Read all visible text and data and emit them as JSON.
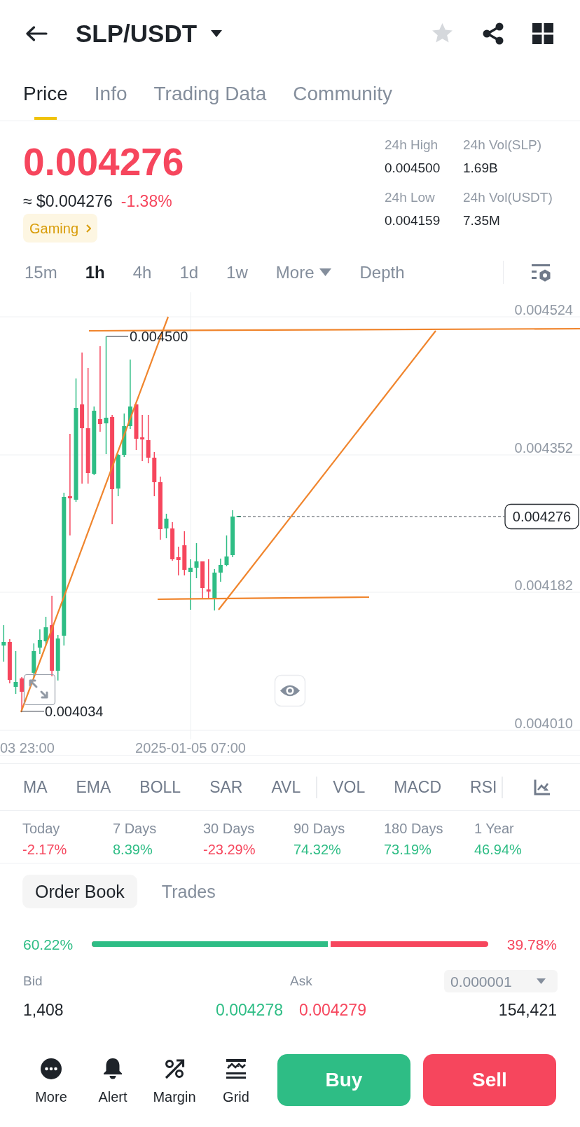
{
  "header": {
    "pair": "SLP/USDT",
    "favorite": false
  },
  "tabs": [
    {
      "label": "Price",
      "selected": true
    },
    {
      "label": "Info",
      "selected": false
    },
    {
      "label": "Trading Data",
      "selected": false
    },
    {
      "label": "Community",
      "selected": false
    }
  ],
  "quote": {
    "last_price": "0.004276",
    "fiat_price": "≈ $0.004276",
    "change": "-1.38%",
    "color": "#f6465d",
    "tag": "Gaming"
  },
  "stats": [
    {
      "label": "24h High",
      "value": "0.004500"
    },
    {
      "label": "24h Vol(SLP)",
      "value": "1.69B"
    },
    {
      "label": "24h Low",
      "value": "0.004159"
    },
    {
      "label": "24h Vol(USDT)",
      "value": "7.35M"
    }
  ],
  "intervals": [
    {
      "label": "15m",
      "kind": "option",
      "selected": false
    },
    {
      "label": "1h",
      "kind": "option",
      "selected": true
    },
    {
      "label": "4h",
      "kind": "option",
      "selected": false
    },
    {
      "label": "1d",
      "kind": "option",
      "selected": false
    },
    {
      "label": "1w",
      "kind": "option",
      "selected": false
    },
    {
      "label": "More",
      "kind": "menu",
      "selected": false
    },
    {
      "label": "Depth",
      "kind": "option",
      "selected": false
    }
  ],
  "chart": {
    "price_axis": [
      "0.004524",
      "0.004352",
      "0.004182",
      "0.004010"
    ],
    "time_axis": [
      "03 23:00",
      "2025-01-05 07:00"
    ],
    "high_marker": "0.004500",
    "low_marker": "0.004034",
    "last_price_tag": "0.004276"
  },
  "indicators": {
    "main": [
      "MA",
      "EMA",
      "BOLL",
      "SAR",
      "AVL"
    ],
    "sub": [
      "VOL",
      "MACD",
      "RSI"
    ]
  },
  "performance": [
    {
      "period": "Today",
      "change": "-2.17%",
      "color": "#f6465d"
    },
    {
      "period": "7 Days",
      "change": "8.39%",
      "color": "#2ebd85"
    },
    {
      "period": "30 Days",
      "change": "-23.29%",
      "color": "#f6465d"
    },
    {
      "period": "90 Days",
      "change": "74.32%",
      "color": "#2ebd85"
    },
    {
      "period": "180 Days",
      "change": "73.19%",
      "color": "#2ebd85"
    },
    {
      "period": "1 Year",
      "change": "46.94%",
      "color": "#2ebd85"
    }
  ],
  "book_tabs": [
    {
      "label": "Order Book",
      "selected": true
    },
    {
      "label": "Trades",
      "selected": false
    }
  ],
  "ratio": {
    "bid_share": "60.22%",
    "ask_share": "39.78%",
    "level": 0.6022
  },
  "order_book": {
    "bid_header": "Bid",
    "ask_header": "Ask",
    "precision": "0.000001",
    "rows": [
      {
        "bid_amount": "1,408",
        "bid_price": "0.004278",
        "ask_price": "0.004279",
        "ask_amount": "154,421"
      }
    ]
  },
  "actions": [
    {
      "label": "More",
      "kind": "more"
    },
    {
      "label": "Alert",
      "kind": "alert"
    },
    {
      "label": "Margin",
      "kind": "margin"
    },
    {
      "label": "Grid",
      "kind": "grid"
    }
  ],
  "trade_buttons": [
    {
      "label": "Buy",
      "kind": "buy"
    },
    {
      "label": "Sell",
      "kind": "sell"
    }
  ]
}
